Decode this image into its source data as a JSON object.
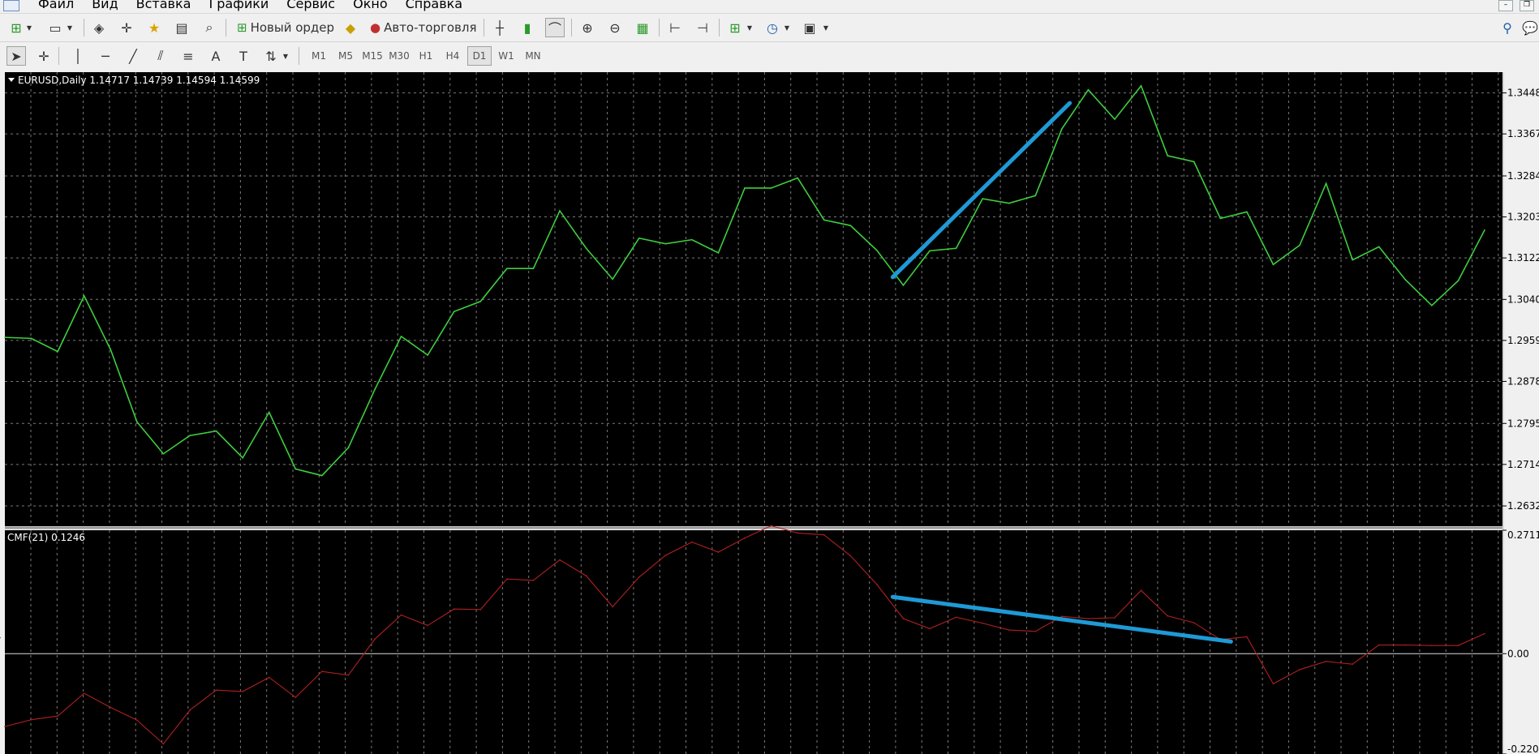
{
  "menu": {
    "items": [
      "Файл",
      "Вид",
      "Вставка",
      "Графики",
      "Сервис",
      "Окно",
      "Справка"
    ]
  },
  "toolbar": {
    "new_order_label": "Новый ордер",
    "autotrading_label": "Авто-торговля",
    "timeframes": [
      "M1",
      "M5",
      "M15",
      "M30",
      "H1",
      "H4",
      "D1",
      "W1",
      "MN"
    ],
    "active_timeframe": "D1"
  },
  "chart_data": [
    {
      "type": "line",
      "title": "EURUSD,Daily  1.14717 1.14739 1.14594 1.14599",
      "ylim": [
        1.2592,
        1.3489
      ],
      "y_ticks": [
        "1.3448",
        "1.3367",
        "1.3284",
        "1.3203",
        "1.3122",
        "1.3040",
        "1.2959",
        "1.2878",
        "1.2795",
        "1.2714",
        "1.2632"
      ],
      "x": [
        0,
        1,
        2,
        3,
        4,
        5,
        6,
        7,
        8,
        9,
        10,
        11,
        12,
        13,
        14,
        15,
        16,
        17,
        18,
        19,
        20,
        21,
        22,
        23,
        24,
        25,
        26,
        27,
        28,
        29,
        30,
        31,
        32,
        33,
        34,
        35,
        36,
        37,
        38,
        39,
        40,
        41,
        42,
        43,
        44,
        45,
        46,
        47,
        48,
        49,
        50,
        51,
        52,
        53,
        54,
        55,
        56
      ],
      "values": [
        1.2965,
        1.2963,
        1.2937,
        1.3047,
        1.2941,
        1.2798,
        1.2735,
        1.2771,
        1.278,
        1.2727,
        1.2817,
        1.2705,
        1.2692,
        1.2747,
        1.2862,
        1.2967,
        1.293,
        1.3016,
        1.3036,
        1.3101,
        1.3101,
        1.3215,
        1.3141,
        1.308,
        1.3161,
        1.315,
        1.3158,
        1.3132,
        1.326,
        1.326,
        1.328,
        1.3197,
        1.3186,
        1.3137,
        1.3068,
        1.3136,
        1.3141,
        1.3239,
        1.323,
        1.3245,
        1.3377,
        1.3454,
        1.3396,
        1.3462,
        1.3324,
        1.3312,
        1.32,
        1.3213,
        1.3109,
        1.3147,
        1.3269,
        1.3118,
        1.3144,
        1.3079,
        1.3028,
        1.3077,
        1.3177
      ],
      "grid": true,
      "line_color": "#3ece3e",
      "annotations": [
        {
          "type": "trendline",
          "color": "#1e9ad6",
          "from": {
            "x": 33.6,
            "y": 1.3084
          },
          "to": {
            "x": 40.3,
            "y": 1.3428
          }
        }
      ]
    },
    {
      "type": "line",
      "title": "CMF(21) 0.1246",
      "ylim": [
        -0.2203,
        0.2711
      ],
      "y_ticks": [
        "0.2711",
        "0.00",
        "-0.2203"
      ],
      "x": [
        0,
        1,
        2,
        3,
        4,
        5,
        6,
        7,
        8,
        9,
        10,
        11,
        12,
        13,
        14,
        15,
        16,
        17,
        18,
        19,
        20,
        21,
        22,
        23,
        24,
        25,
        26,
        27,
        28,
        29,
        30,
        31,
        32,
        33,
        34,
        35,
        36,
        37,
        38,
        39,
        40,
        41,
        42,
        43,
        44,
        45,
        46,
        47,
        48,
        49,
        50,
        51,
        52,
        53,
        54,
        55,
        56
      ],
      "values": [
        -0.16,
        -0.145,
        -0.137,
        -0.087,
        -0.118,
        -0.146,
        -0.198,
        -0.124,
        -0.08,
        -0.083,
        -0.052,
        -0.096,
        -0.039,
        -0.047,
        0.032,
        0.085,
        0.062,
        0.098,
        0.097,
        0.164,
        0.161,
        0.206,
        0.171,
        0.103,
        0.168,
        0.216,
        0.245,
        0.223,
        0.254,
        0.281,
        0.265,
        0.261,
        0.215,
        0.152,
        0.077,
        0.055,
        0.08,
        0.067,
        0.052,
        0.049,
        0.082,
        0.077,
        0.079,
        0.139,
        0.083,
        0.068,
        0.031,
        0.037,
        -0.066,
        -0.035,
        -0.017,
        -0.023,
        0.019,
        0.019,
        0.018,
        0.018,
        0.044,
        0.035
      ],
      "grid": true,
      "line_color": "#b02020",
      "zero_line": true,
      "annotations": [
        {
          "type": "trendline",
          "color": "#1e9ad6",
          "from": {
            "x": 33.6,
            "y": 0.1246
          },
          "to": {
            "x": 46.4,
            "y": 0.0265
          }
        }
      ]
    }
  ]
}
